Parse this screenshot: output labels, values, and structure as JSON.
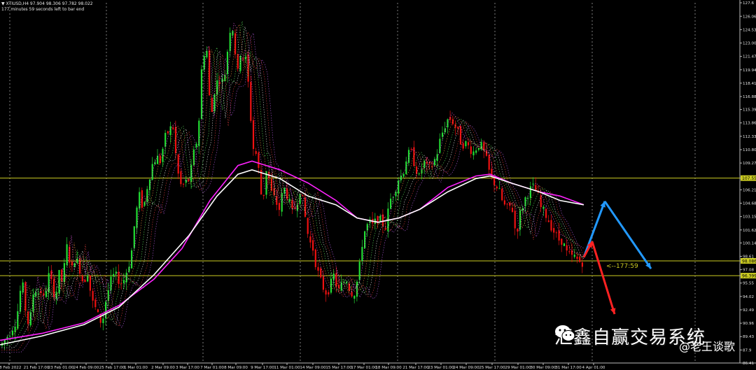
{
  "header": {
    "symbol_line": "▼ XTIUSD,H4  97.904 98.306 97.782 98.022",
    "timer_line": "177 minutes 59 seconds left to bar end"
  },
  "countdown_label": "<--177:59",
  "watermark": {
    "main_text": "汇鑫自赢交易系统",
    "sub_text": "@老王谈歌"
  },
  "colors": {
    "background": "#000000",
    "bull": "#22dd33",
    "bear": "#ee1111",
    "ma_slow": "#ff22ff",
    "ma_fast": "#ffffff",
    "level_lines": "#cccc22",
    "arrow_up": "#2299ff",
    "arrow_down": "#ff2222",
    "current_price_tag": "#cccc22"
  },
  "chart_data": {
    "type": "candlestick",
    "symbol": "XTIUSD",
    "timeframe": "H4",
    "ohlc_current": {
      "open": 97.904,
      "high": 98.306,
      "low": 97.782,
      "close": 98.022
    },
    "y_range": [
      86.41,
      127.6
    ],
    "y_ticks": [
      127.6,
      126.06,
      124.535,
      123.0,
      121.47,
      119.94,
      118.41,
      116.88,
      115.395,
      113.865,
      112.335,
      110.805,
      109.275,
      107.554,
      106.215,
      104.685,
      103.155,
      101.625,
      100.14,
      98.61,
      98.086,
      97.08,
      96.399,
      95.55,
      94.02,
      92.49,
      90.96,
      89.43,
      87.9,
      86.41
    ],
    "highlighted_levels": [
      {
        "price": 107.554,
        "label": "107.554"
      },
      {
        "price": 98.086,
        "label": "98.086"
      },
      {
        "price": 96.399,
        "label": "96.399"
      }
    ],
    "x_labels": [
      "18 Feb 2022",
      "21 Feb 17:00",
      "23 Feb 01:00",
      "24 Feb 09:00",
      "25 Feb 17:00",
      "1 Mar 01:00",
      "2 Mar 09:00",
      "3 Mar 17:00",
      "7 Mar 01:00",
      "8 Mar 09:00",
      "9 Mar 17:00",
      "11 Mar 01:00",
      "14 Mar 09:00",
      "15 Mar 17:00",
      "17 Mar 01:00",
      "18 Mar 09:00",
      "21 Mar 17:00",
      "23 Mar 01:00",
      "24 Mar 09:00",
      "25 Mar 17:00",
      "29 Mar 01:00",
      "30 Mar 09:00",
      "31 Mar 17:00",
      "4 Apr 01:00"
    ],
    "price_path": [
      [
        0,
        88.4
      ],
      [
        8,
        89.3
      ],
      [
        16,
        90.4
      ],
      [
        23,
        91.5
      ],
      [
        27,
        94.5
      ],
      [
        33,
        95.2
      ],
      [
        36,
        91.8
      ],
      [
        40,
        90.8
      ],
      [
        44,
        92.2
      ],
      [
        48,
        95.8
      ],
      [
        52,
        94.0
      ],
      [
        56,
        95.0
      ],
      [
        62,
        93.5
      ],
      [
        68,
        96.5
      ],
      [
        74,
        95.2
      ],
      [
        78,
        93.8
      ],
      [
        84,
        96.8
      ],
      [
        88,
        95.5
      ],
      [
        92,
        98.2
      ],
      [
        96,
        100.5
      ],
      [
        100,
        96.5
      ],
      [
        106,
        98.5
      ],
      [
        112,
        97.5
      ],
      [
        118,
        95.5
      ],
      [
        124,
        97.0
      ],
      [
        130,
        93.5
      ],
      [
        136,
        92.5
      ],
      [
        140,
        91.5
      ],
      [
        145,
        91.0
      ],
      [
        150,
        93.5
      ],
      [
        156,
        95.5
      ],
      [
        162,
        96.5
      ],
      [
        168,
        96.0
      ],
      [
        174,
        95.5
      ],
      [
        180,
        97.0
      ],
      [
        186,
        98.5
      ],
      [
        192,
        103.0
      ],
      [
        198,
        105.5
      ],
      [
        204,
        104.0
      ],
      [
        210,
        107.0
      ],
      [
        216,
        109.0
      ],
      [
        222,
        110.0
      ],
      [
        228,
        109.5
      ],
      [
        234,
        112.0
      ],
      [
        240,
        113.0
      ],
      [
        246,
        113.5
      ],
      [
        252,
        108.5
      ],
      [
        258,
        106.5
      ],
      [
        264,
        107.0
      ],
      [
        270,
        107.5
      ],
      [
        276,
        110.5
      ],
      [
        282,
        112.5
      ],
      [
        288,
        121.5
      ],
      [
        294,
        122.5
      ],
      [
        300,
        114.0
      ],
      [
        306,
        118.0
      ],
      [
        312,
        119.0
      ],
      [
        318,
        118.5
      ],
      [
        322,
        120.5
      ],
      [
        326,
        124.0
      ],
      [
        330,
        125.5
      ],
      [
        334,
        123.0
      ],
      [
        338,
        119.0
      ],
      [
        342,
        122.0
      ],
      [
        346,
        121.5
      ],
      [
        350,
        121.0
      ],
      [
        354,
        118.0
      ],
      [
        358,
        113.5
      ],
      [
        362,
        110.0
      ],
      [
        366,
        110.5
      ],
      [
        370,
        107.0
      ],
      [
        374,
        104.5
      ],
      [
        380,
        109.0
      ],
      [
        386,
        106.0
      ],
      [
        392,
        105.0
      ],
      [
        398,
        104.0
      ],
      [
        404,
        106.5
      ],
      [
        410,
        105.5
      ],
      [
        416,
        103.5
      ],
      [
        422,
        104.5
      ],
      [
        428,
        106.5
      ],
      [
        434,
        103.5
      ],
      [
        440,
        100.5
      ],
      [
        446,
        99.5
      ],
      [
        452,
        97.0
      ],
      [
        458,
        95.5
      ],
      [
        464,
        94.5
      ],
      [
        470,
        95.0
      ],
      [
        476,
        96.5
      ],
      [
        482,
        94.5
      ],
      [
        488,
        95.5
      ],
      [
        494,
        96.0
      ],
      [
        500,
        94.5
      ],
      [
        506,
        94.5
      ],
      [
        512,
        97.0
      ],
      [
        516,
        100.0
      ],
      [
        520,
        101.5
      ],
      [
        526,
        102.5
      ],
      [
        532,
        102.0
      ],
      [
        538,
        103.0
      ],
      [
        544,
        102.5
      ],
      [
        550,
        102.0
      ],
      [
        556,
        105.0
      ],
      [
        562,
        106.0
      ],
      [
        568,
        107.5
      ],
      [
        574,
        108.0
      ],
      [
        580,
        110.0
      ],
      [
        586,
        110.5
      ],
      [
        592,
        109.0
      ],
      [
        598,
        107.5
      ],
      [
        604,
        109.5
      ],
      [
        610,
        108.5
      ],
      [
        616,
        109.0
      ],
      [
        622,
        110.0
      ],
      [
        628,
        112.0
      ],
      [
        634,
        113.5
      ],
      [
        640,
        114.5
      ],
      [
        646,
        114.0
      ],
      [
        652,
        113.0
      ],
      [
        658,
        111.5
      ],
      [
        664,
        111.5
      ],
      [
        670,
        111.0
      ],
      [
        676,
        110.5
      ],
      [
        682,
        111.5
      ],
      [
        688,
        111.0
      ],
      [
        694,
        109.5
      ],
      [
        700,
        107.5
      ],
      [
        706,
        107.0
      ],
      [
        712,
        106.0
      ],
      [
        718,
        104.5
      ],
      [
        724,
        104.0
      ],
      [
        730,
        104.5
      ],
      [
        736,
        101.0
      ],
      [
        742,
        103.5
      ],
      [
        748,
        105.0
      ],
      [
        754,
        106.0
      ],
      [
        760,
        106.5
      ],
      [
        766,
        106.0
      ],
      [
        772,
        104.0
      ],
      [
        778,
        103.5
      ],
      [
        784,
        102.5
      ],
      [
        790,
        101.5
      ],
      [
        796,
        100.5
      ],
      [
        802,
        100.5
      ],
      [
        808,
        99.0
      ],
      [
        814,
        98.5
      ],
      [
        820,
        98.5
      ],
      [
        826,
        98.0
      ],
      [
        832,
        98.0
      ]
    ],
    "ma_white": [
      [
        0,
        88.5
      ],
      [
        60,
        89.5
      ],
      [
        120,
        90.8
      ],
      [
        170,
        92.8
      ],
      [
        220,
        96.5
      ],
      [
        270,
        101.0
      ],
      [
        310,
        105.5
      ],
      [
        340,
        108.0
      ],
      [
        360,
        108.5
      ],
      [
        400,
        107.5
      ],
      [
        440,
        105.5
      ],
      [
        480,
        104.5
      ],
      [
        510,
        103.0
      ],
      [
        540,
        102.5
      ],
      [
        570,
        103.0
      ],
      [
        600,
        104.0
      ],
      [
        640,
        106.0
      ],
      [
        680,
        107.5
      ],
      [
        700,
        107.8
      ],
      [
        730,
        107.0
      ],
      [
        770,
        106.0
      ],
      [
        800,
        105.0
      ],
      [
        834,
        104.5
      ]
    ],
    "ma_magenta": [
      [
        0,
        89.0
      ],
      [
        60,
        89.8
      ],
      [
        120,
        91.0
      ],
      [
        170,
        93.0
      ],
      [
        220,
        96.0
      ],
      [
        260,
        99.5
      ],
      [
        300,
        105.0
      ],
      [
        340,
        109.0
      ],
      [
        360,
        109.5
      ],
      [
        400,
        108.5
      ],
      [
        440,
        107.0
      ],
      [
        480,
        105.0
      ],
      [
        510,
        103.0
      ],
      [
        540,
        102.5
      ],
      [
        570,
        103.0
      ],
      [
        600,
        104.0
      ],
      [
        640,
        106.5
      ],
      [
        680,
        107.8
      ],
      [
        700,
        108.0
      ],
      [
        730,
        107.0
      ],
      [
        770,
        106.0
      ],
      [
        800,
        105.5
      ],
      [
        834,
        104.5
      ]
    ],
    "projection_arrows": [
      {
        "color": "arrow_up",
        "points": [
          [
            834,
            98.5
          ],
          [
            864,
            104.9
          ],
          [
            930,
            97.2
          ]
        ]
      },
      {
        "color": "arrow_down",
        "points": [
          [
            834,
            98.5
          ],
          [
            846,
            100.3
          ],
          [
            878,
            92.0
          ]
        ]
      }
    ],
    "current_price": 98.086
  }
}
